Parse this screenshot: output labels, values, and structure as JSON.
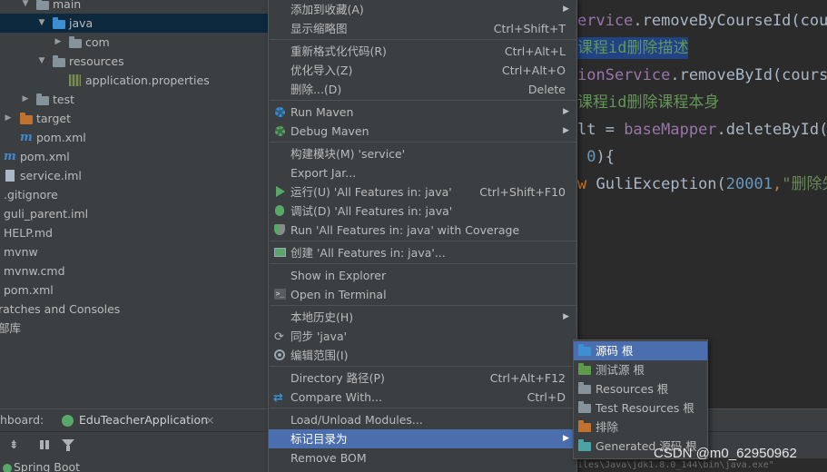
{
  "project_tree": [
    {
      "label": "main",
      "arrow": "▼",
      "icon": "folder",
      "depth": "d1",
      "selected": false
    },
    {
      "label": "java",
      "arrow": "▼",
      "icon": "folder-blue",
      "depth": "d2",
      "selected": true
    },
    {
      "label": "com",
      "arrow": "▶",
      "icon": "folder",
      "depth": "d3",
      "selected": false
    },
    {
      "label": "resources",
      "arrow": "▼",
      "icon": "folder",
      "depth": "d2",
      "selected": false
    },
    {
      "label": "application.properties",
      "arrow": "",
      "icon": "properties-file",
      "depth": "d3",
      "selected": false
    },
    {
      "label": "test",
      "arrow": "▶",
      "icon": "folder",
      "depth": "d1",
      "selected": false
    },
    {
      "label": "target",
      "arrow": "▶",
      "icon": "folder-orange",
      "depth": "d0",
      "selected": false
    },
    {
      "label": "pom.xml",
      "arrow": "",
      "icon": "maven",
      "depth": "d1b",
      "selected": false
    },
    {
      "label": "pom.xml",
      "arrow": "",
      "icon": "maven",
      "depth": "r0",
      "selected": false
    },
    {
      "label": "service.iml",
      "arrow": "",
      "icon": "file",
      "depth": "r0",
      "selected": false
    },
    {
      "label": ".gitignore",
      "arrow": "",
      "icon": "none",
      "depth": "r-1",
      "selected": false
    },
    {
      "label": "guli_parent.iml",
      "arrow": "",
      "icon": "none",
      "depth": "r-1",
      "selected": false
    },
    {
      "label": "HELP.md",
      "arrow": "",
      "icon": "none",
      "depth": "r-1",
      "selected": false
    },
    {
      "label": "mvnw",
      "arrow": "",
      "icon": "none",
      "depth": "r-1",
      "selected": false
    },
    {
      "label": "mvnw.cmd",
      "arrow": "",
      "icon": "none",
      "depth": "r-1",
      "selected": false
    },
    {
      "label": "pom.xml",
      "arrow": "",
      "icon": "none",
      "depth": "r-1",
      "selected": false
    },
    {
      "label": "ratches and Consoles",
      "arrow": "",
      "icon": "none",
      "depth": "r-2",
      "selected": false
    },
    {
      "label": "部库",
      "arrow": "",
      "icon": "none",
      "depth": "r-2",
      "selected": false
    }
  ],
  "editor_lines": [
    {
      "parts": [
        {
          "t": "ervice",
          "c": "c-field"
        },
        {
          "t": ".removeByCourseId(cour",
          "c": "c-id"
        }
      ],
      "highlight": false
    },
    {
      "parts": [
        {
          "t": "课程id删除描述",
          "c": "c-cmt"
        }
      ],
      "highlight": true
    },
    {
      "parts": [
        {
          "t": "ionService",
          "c": "c-field"
        },
        {
          "t": ".removeById(course",
          "c": "c-id"
        }
      ],
      "highlight": false
    },
    {
      "parts": [
        {
          "t": "课程id删除课程本身",
          "c": "c-cmt"
        }
      ],
      "highlight": false
    },
    {
      "parts": [
        {
          "t": "lt = ",
          "c": "c-id"
        },
        {
          "t": "baseMapper",
          "c": "c-field"
        },
        {
          "t": ".deleteById(c",
          "c": "c-id"
        }
      ],
      "highlight": false
    },
    {
      "parts": [
        {
          "t": " ",
          "c": "c-id"
        },
        {
          "t": "0",
          "c": "c-num"
        },
        {
          "t": "){",
          "c": "c-id"
        }
      ],
      "highlight": false
    },
    {
      "parts": [
        {
          "t": "w ",
          "c": "c-kw"
        },
        {
          "t": "GuliException(",
          "c": "c-id"
        },
        {
          "t": "20001",
          "c": "c-num"
        },
        {
          "t": ",",
          "c": "c-kw"
        },
        {
          "t": "\"删除失",
          "c": "c-str"
        }
      ],
      "highlight": false
    }
  ],
  "services": {
    "tab_prefix": "hboard:",
    "tab_app": "EduTeacherApplication",
    "tab_close": "×",
    "tree_item": "Spring Boot",
    "console_text": "iles\\Java\\jdk1.8.0_144\\bin\\java.exe\""
  },
  "context_menu": [
    {
      "label": "添加到收藏(A)",
      "shortcut": "",
      "submenu": true,
      "icon": "",
      "selected": false
    },
    {
      "label": "显示缩略图",
      "shortcut": "Ctrl+Shift+T",
      "submenu": false,
      "icon": "",
      "selected": false
    },
    {
      "sep": true
    },
    {
      "label": "重新格式化代码(R)",
      "shortcut": "Ctrl+Alt+L",
      "submenu": false,
      "icon": "",
      "selected": false
    },
    {
      "label": "优化导入(Z)",
      "shortcut": "Ctrl+Alt+O",
      "submenu": false,
      "icon": "",
      "selected": false
    },
    {
      "label": "删除...(D)",
      "shortcut": "Delete",
      "submenu": false,
      "icon": "",
      "selected": false
    },
    {
      "sep": true
    },
    {
      "label": "Run Maven",
      "shortcut": "",
      "submenu": true,
      "icon": "maven-gear-icon",
      "selected": false
    },
    {
      "label": "Debug Maven",
      "shortcut": "",
      "submenu": true,
      "icon": "maven-debug-icon",
      "selected": false
    },
    {
      "sep": true
    },
    {
      "label": "构建模块(M) 'service'",
      "shortcut": "",
      "submenu": false,
      "icon": "",
      "selected": false
    },
    {
      "label": "Export Jar...",
      "shortcut": "",
      "submenu": false,
      "icon": "",
      "selected": false
    },
    {
      "label": "运行(U) 'All Features in: java'",
      "shortcut": "Ctrl+Shift+F10",
      "submenu": false,
      "icon": "run-icon",
      "selected": false
    },
    {
      "label": "调试(D) 'All Features in: java'",
      "shortcut": "",
      "submenu": false,
      "icon": "debug-icon",
      "selected": false
    },
    {
      "label": "Run 'All Features in: java' with Coverage",
      "shortcut": "",
      "submenu": false,
      "icon": "coverage-icon",
      "selected": false
    },
    {
      "sep": true
    },
    {
      "label": "创建 'All Features in: java'...",
      "shortcut": "",
      "submenu": false,
      "icon": "create-config-icon",
      "selected": false
    },
    {
      "sep": true
    },
    {
      "label": "Show in Explorer",
      "shortcut": "",
      "submenu": false,
      "icon": "",
      "selected": false
    },
    {
      "label": "Open in Terminal",
      "shortcut": "",
      "submenu": false,
      "icon": "terminal-icon",
      "selected": false
    },
    {
      "sep": true
    },
    {
      "label": "本地历史(H)",
      "shortcut": "",
      "submenu": true,
      "icon": "",
      "selected": false
    },
    {
      "label": "同步 'java'",
      "shortcut": "",
      "submenu": false,
      "icon": "sync-icon",
      "selected": false
    },
    {
      "label": "编辑范围(I)",
      "shortcut": "",
      "submenu": false,
      "icon": "scope-icon",
      "selected": false
    },
    {
      "sep": true
    },
    {
      "label": "Directory 路径(P)",
      "shortcut": "Ctrl+Alt+F12",
      "submenu": false,
      "icon": "",
      "selected": false
    },
    {
      "label": "Compare With...",
      "shortcut": "Ctrl+D",
      "submenu": false,
      "icon": "compare-icon",
      "selected": false
    },
    {
      "sep": true
    },
    {
      "label": "Load/Unload Modules...",
      "shortcut": "",
      "submenu": false,
      "icon": "",
      "selected": false
    },
    {
      "label": "标记目录为",
      "shortcut": "",
      "submenu": true,
      "icon": "",
      "selected": true
    },
    {
      "label": "Remove BOM",
      "shortcut": "",
      "submenu": false,
      "icon": "",
      "selected": false
    }
  ],
  "submenu": [
    {
      "label": "源码 根",
      "icon": "folder-blue",
      "selected": true
    },
    {
      "label": "测试源 根",
      "icon": "folder-green",
      "selected": false
    },
    {
      "label": "Resources 根",
      "icon": "folder",
      "selected": false
    },
    {
      "label": "Test Resources 根",
      "icon": "folder",
      "selected": false
    },
    {
      "label": "排除",
      "icon": "folder-orange",
      "selected": false
    },
    {
      "label": "Generated 源码 根",
      "icon": "folder-teal",
      "selected": false
    }
  ],
  "watermark": "CSDN @m0_62950962"
}
